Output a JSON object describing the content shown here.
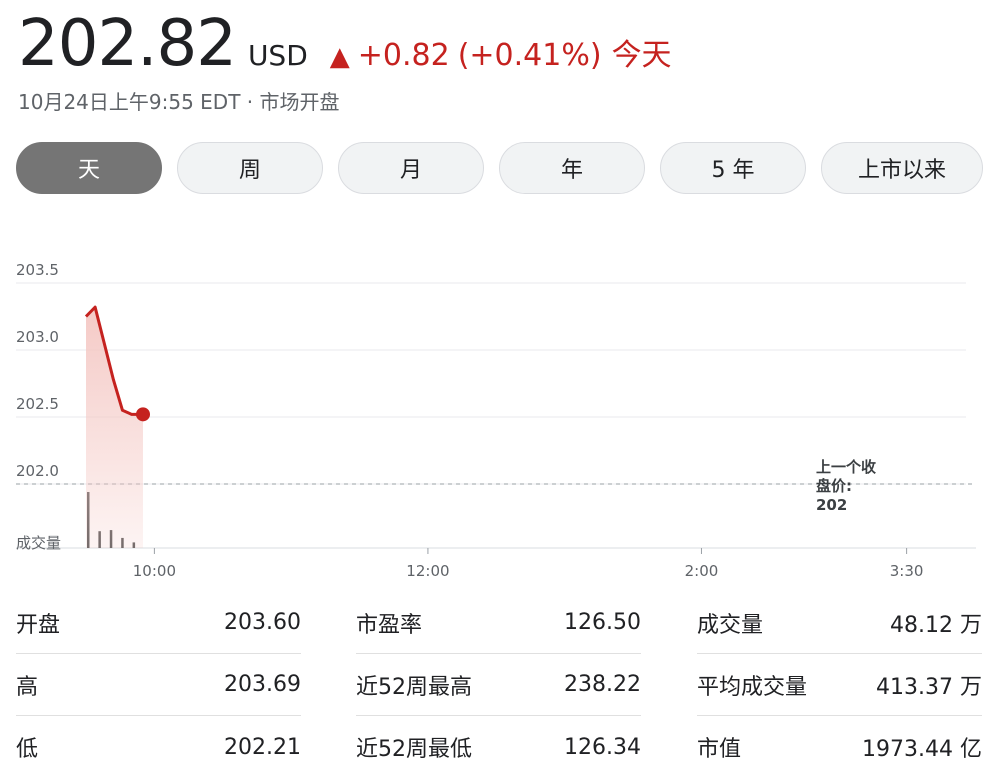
{
  "quote": {
    "price": "202.82",
    "currency": "USD",
    "change_arrow": "▲",
    "change": "+0.82",
    "change_pct": "(+0.41%)",
    "change_period": "今天",
    "timestamp": "10月24日上午9:55 EDT · 市场开盘",
    "up_color": "#c5221f"
  },
  "range_tabs": [
    {
      "label": "天",
      "active": true
    },
    {
      "label": "周",
      "active": false
    },
    {
      "label": "月",
      "active": false
    },
    {
      "label": "年",
      "active": false
    },
    {
      "label": "5 年",
      "active": false
    },
    {
      "label": "上市以来",
      "active": false
    }
  ],
  "chart_data": {
    "type": "line",
    "title": "",
    "x_tick_labels": [
      "10:00",
      "12:00",
      "2:00",
      "3:30"
    ],
    "y_tick_labels": [
      "203.5",
      "203.0",
      "202.5",
      "202.0"
    ],
    "y_ticks": [
      203.5,
      203.0,
      202.5,
      202.0
    ],
    "ylim": [
      201.5,
      203.6
    ],
    "x_range_minutes": [
      0,
      390
    ],
    "x_tick_minutes": [
      30,
      150,
      270,
      360
    ],
    "series": [
      {
        "x_minutes": [
          0,
          4,
          8,
          12,
          16,
          20,
          25
        ],
        "values": [
          203.25,
          203.32,
          203.05,
          202.78,
          202.55,
          202.52,
          202.52
        ]
      }
    ],
    "last_point_marker": true,
    "previous_close": {
      "label_lines": [
        "上一个收",
        "盘价:",
        "202"
      ],
      "value": 202.0
    },
    "volume": {
      "label": "成交量",
      "x_minutes": [
        0,
        5,
        10,
        15,
        20
      ],
      "relative_heights": [
        1.0,
        0.3,
        0.32,
        0.18,
        0.1
      ]
    },
    "line_color": "#c5221f",
    "fill_color": "#f4c7c3",
    "grid": true
  },
  "stats": {
    "columns": [
      [
        {
          "label": "开盘",
          "value": "203.60"
        },
        {
          "label": "高",
          "value": "203.69"
        },
        {
          "label": "低",
          "value": "202.21"
        }
      ],
      [
        {
          "label": "市盈率",
          "value": "126.50"
        },
        {
          "label": "近52周最高",
          "value": "238.22"
        },
        {
          "label": "近52周最低",
          "value": "126.34"
        }
      ],
      [
        {
          "label": "成交量",
          "value": "48.12 万"
        },
        {
          "label": "平均成交量",
          "value": "413.37 万"
        },
        {
          "label": "市值",
          "value": "1973.44 亿"
        }
      ]
    ]
  }
}
